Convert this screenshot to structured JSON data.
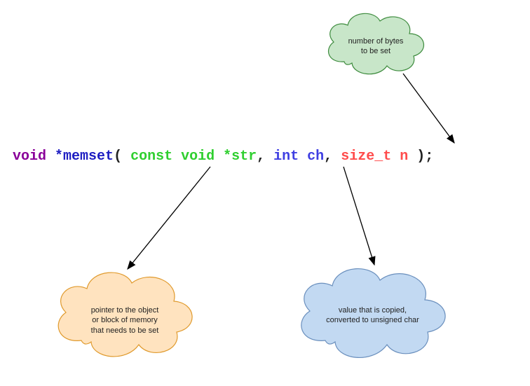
{
  "signature": {
    "token_void": "void",
    "token_star": "*",
    "token_name": "memset",
    "token_open": "(",
    "token_param1": "const void *str",
    "token_comma": ",",
    "token_param2": "int ch",
    "token_param3": "size_t n",
    "token_close": ");"
  },
  "annotations": {
    "bytes": {
      "line1": "number of bytes",
      "line2": "to be set"
    },
    "pointer": {
      "line1": "pointer to the object",
      "line2": "or block of memory",
      "line3": "that needs to be set"
    },
    "value": {
      "line1": "value that is copied,",
      "line2": "converted to unsigned char"
    }
  },
  "colors": {
    "cloud_top_fill": "#c8e6c9",
    "cloud_top_stroke": "#3d8b3d",
    "cloud_left_fill": "#ffe3bf",
    "cloud_left_stroke": "#e09a2d",
    "cloud_right_fill": "#c2d9f2",
    "cloud_right_stroke": "#6a8fbd"
  }
}
